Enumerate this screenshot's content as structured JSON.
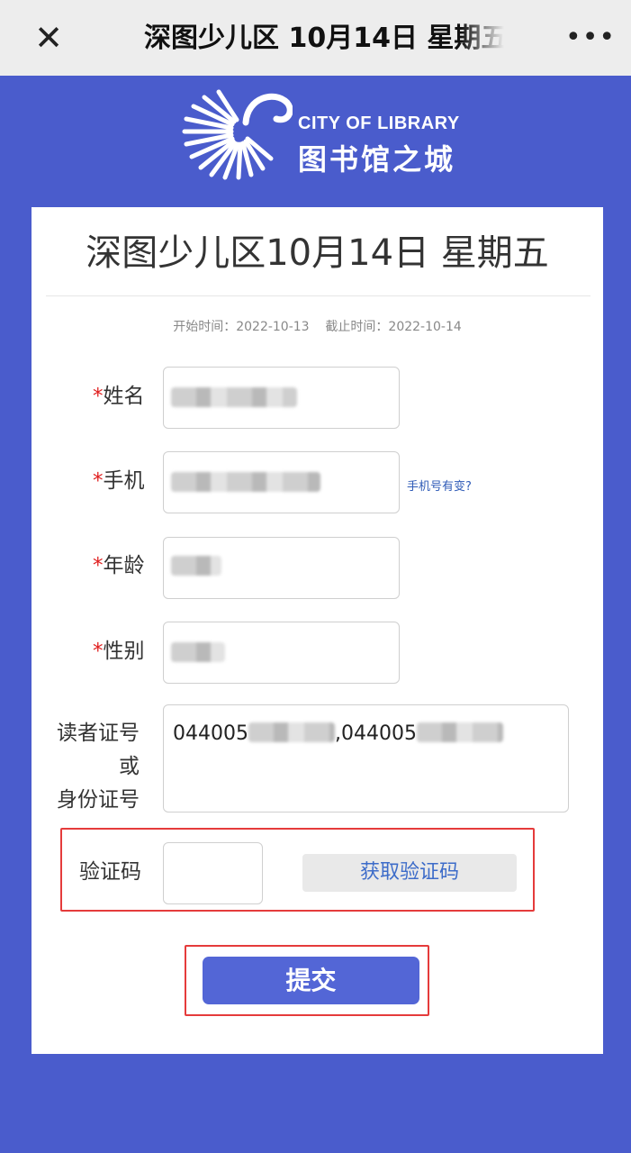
{
  "topbar": {
    "title": "深图少儿区 10月14日 星期五",
    "close_icon": "close-icon",
    "more_icon": "more-icon"
  },
  "logo": {
    "en": "CITY OF LIBRARY",
    "cn": "图书馆之城"
  },
  "form": {
    "title": "深图少儿区10月14日 星期五",
    "start_label": "开始时间：",
    "start_value": "2022-10-13",
    "end_label": "截止时间：",
    "end_value": "2022-10-14",
    "required_mark": "*",
    "name_label": "姓名",
    "phone_label": "手机",
    "phone_change_link": "手机号有变?",
    "age_label": "年龄",
    "gender_label": "性别",
    "id_label_line1": "读者证号",
    "id_label_line2": "或",
    "id_label_line3": "身份证号",
    "id_part1": "044005",
    "id_separator": ",",
    "id_part2": "044005",
    "code_label": "验证码",
    "get_code_button": "获取验证码",
    "submit_button": "提交"
  },
  "colors": {
    "background": "#4a5ccc",
    "submit": "#5366d6",
    "required": "#e02020",
    "link": "#2f5bb7",
    "highlight": "#e53b3b"
  }
}
